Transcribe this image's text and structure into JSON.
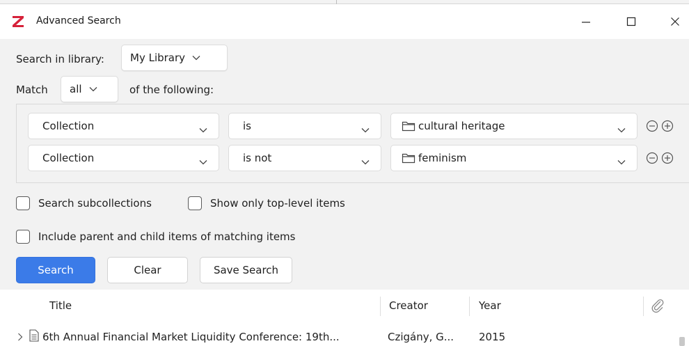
{
  "window": {
    "title": "Advanced Search",
    "logo_color": "#d6223a",
    "controls": {
      "minimize": "minimize-icon",
      "maximize": "maximize-icon",
      "close": "close-icon"
    }
  },
  "search": {
    "library_label": "Search in library:",
    "library_value": "My Library",
    "match_label": "Match",
    "match_value": "all",
    "following_label": "of the following:",
    "conditions": [
      {
        "field": "Collection",
        "operator": "is",
        "value": "cultural heritage"
      },
      {
        "field": "Collection",
        "operator": "is not",
        "value": "feminism"
      }
    ],
    "options": {
      "subcollections": "Search subcollections",
      "top_level": "Show only top-level items",
      "parent_child": "Include parent and child items of matching items"
    },
    "buttons": {
      "search": "Search",
      "clear": "Clear",
      "save": "Save Search"
    },
    "accent_color": "#3b7be8"
  },
  "results": {
    "columns": {
      "title": "Title",
      "creator": "Creator",
      "year": "Year"
    },
    "rows": [
      {
        "title": "6th Annual Financial Market Liquidity Conference: 19th...",
        "creator": "Czigány, G...",
        "year": "2015"
      }
    ]
  }
}
